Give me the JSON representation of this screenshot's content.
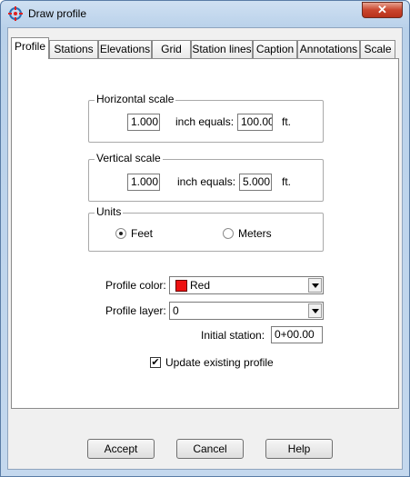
{
  "window": {
    "title": "Draw profile",
    "close_glyph": "✕"
  },
  "tabs": [
    "Profile",
    "Stations",
    "Elevations",
    "Grid",
    "Station lines",
    "Caption",
    "Annotations",
    "Scale"
  ],
  "active_tab": "Profile",
  "horizontal_scale": {
    "title": "Horizontal scale",
    "inch_value": "1.000",
    "equals_label": "inch equals:",
    "feet_value": "100.00",
    "unit": "ft."
  },
  "vertical_scale": {
    "title": "Vertical scale",
    "inch_value": "1.000",
    "equals_label": "inch equals:",
    "feet_value": "5.000",
    "unit": "ft."
  },
  "units": {
    "title": "Units",
    "options": [
      "Feet",
      "Meters"
    ],
    "selected": "Feet"
  },
  "profile_color": {
    "label": "Profile color:",
    "value": "Red",
    "swatch": "#e11111"
  },
  "profile_layer": {
    "label": "Profile layer:",
    "value": "0"
  },
  "initial_station": {
    "label": "Initial station:",
    "value": "0+00.00"
  },
  "update_existing": {
    "label": "Update existing profile",
    "checked": true,
    "mark": "✔"
  },
  "buttons": {
    "accept": "Accept",
    "cancel": "Cancel",
    "help": "Help"
  }
}
